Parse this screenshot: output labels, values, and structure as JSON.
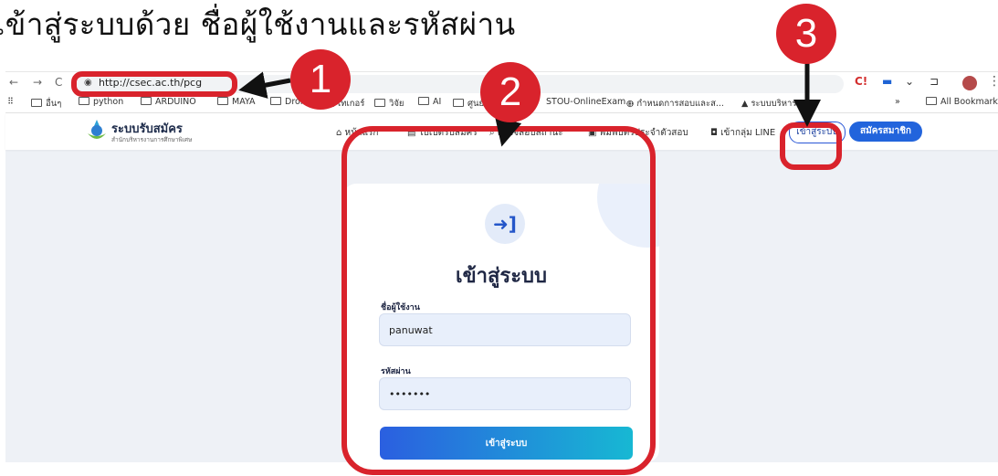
{
  "heading": "เข้าสู่ระบบด้วย ชื่อผู้ใช้งานและรหัสผ่าน",
  "browser": {
    "url": "http://csec.ac.th/pcg",
    "nav_back": "←",
    "nav_forward": "→",
    "nav_reload": "C",
    "bookmarks_icon": "⠿",
    "bookmarks": [
      "อื่นๆ",
      "python",
      "ARDUINO",
      "MAYA",
      "Drone",
      "เทเกอร์",
      "วิจัย",
      "AI",
      "ศูนย์",
      "STOU-OnlineExam...",
      "กำหนดการสอบและส...",
      "ระบบบริหาร..."
    ],
    "bookmarks_more": "»",
    "all_bookmarks": "All Bookmarks",
    "ext_c": "C!",
    "ext_down": "⌄",
    "ext_puzzle": "⊐",
    "ext_menu": "⋮"
  },
  "site": {
    "logo_title": "ระบบรับสมัคร",
    "logo_subtitle": "สำนักบริหารงานการศึกษาพิเศษ",
    "nav": {
      "home": "หน้าแรก",
      "apply": "ใบเปิดรับสมัคร",
      "check_status": "ตรวจสอบสถานะ",
      "print_card": "พิมพ์บัตรประจำตัวสอบ",
      "line_group": "เข้ากลุ่ม LINE",
      "login": "เข้าสู่ระบบ",
      "register": "สมัครสมาชิก"
    }
  },
  "login": {
    "icon": "➜]",
    "title": "เข้าสู่ระบบ",
    "username_label": "ชื่อผู้ใช้งาน",
    "username_value": "panuwat",
    "password_label": "รหัสผ่าน",
    "password_value": "•••••••",
    "submit_label": "เข้าสู่ระบบ"
  },
  "annotations": {
    "step1": "1",
    "step2": "2",
    "step3": "3",
    "accent_color": "#d9232c"
  }
}
